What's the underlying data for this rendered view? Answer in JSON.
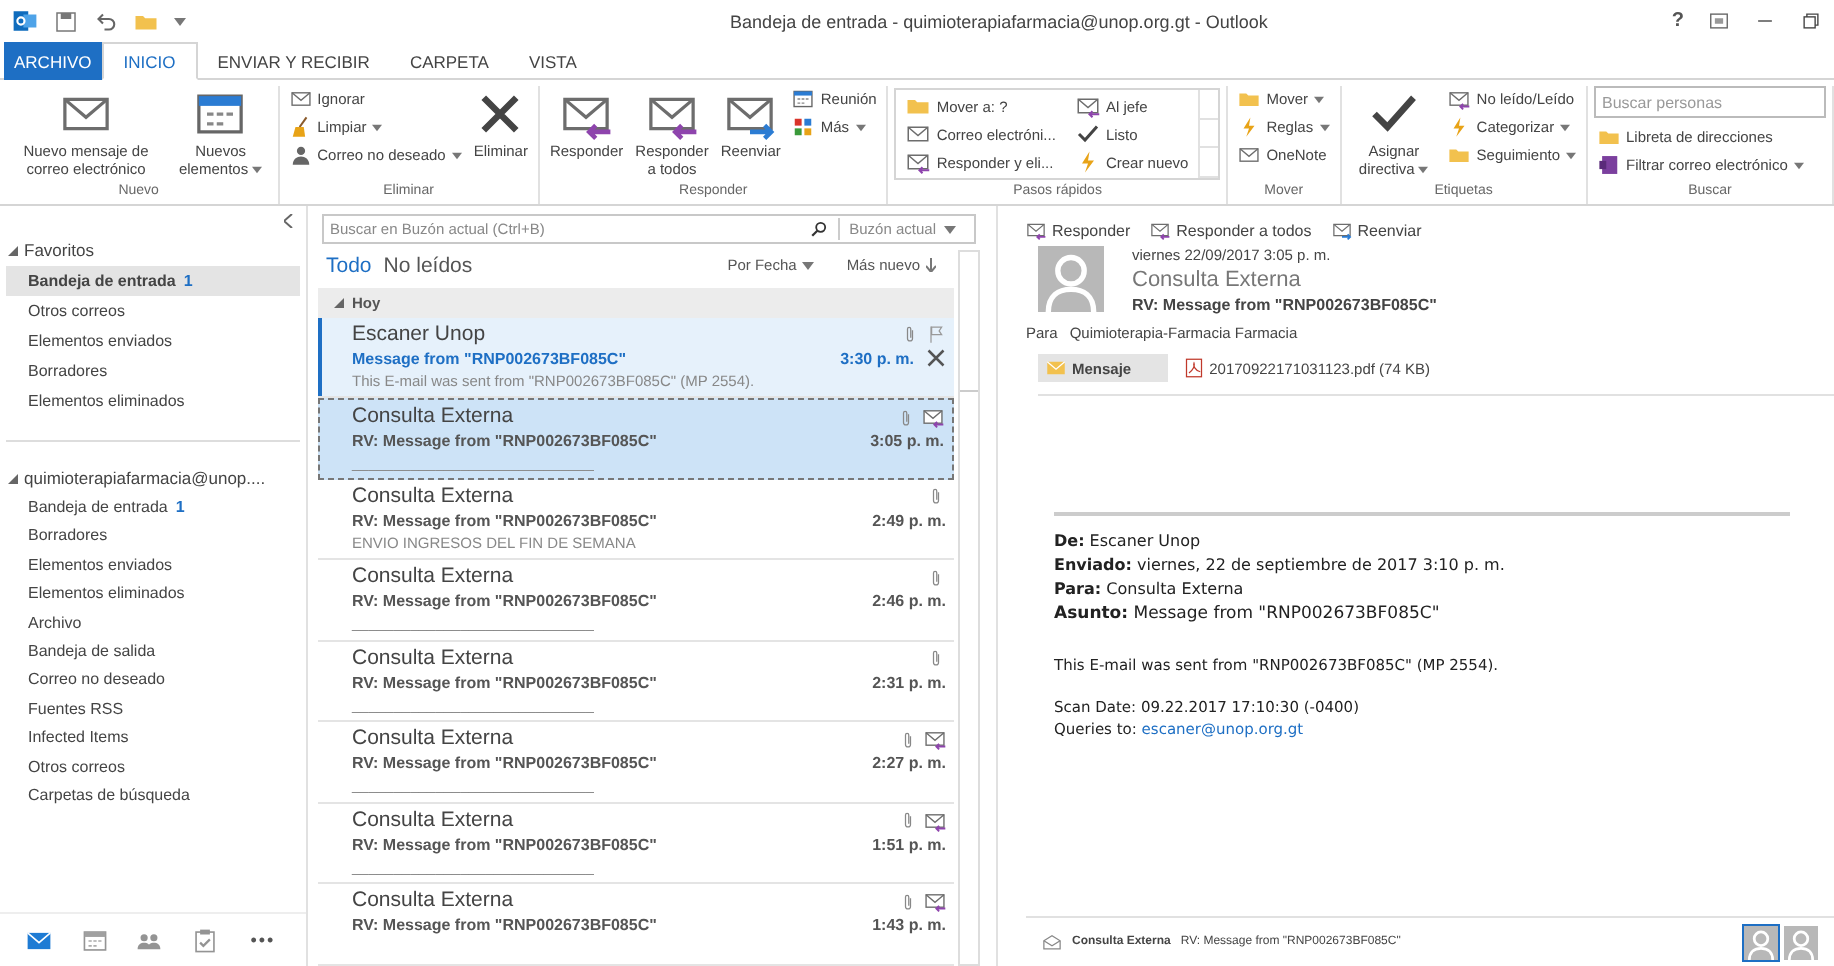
{
  "window": {
    "title": "Bandeja de entrada - quimioterapiafarmacia@unop.org.gt - Outlook",
    "help": "?"
  },
  "ribbon_tabs": [
    {
      "label": "ARCHIVO",
      "kind": "file",
      "selected": false
    },
    {
      "label": "INICIO",
      "kind": "tab",
      "selected": true
    },
    {
      "label": "ENVIAR Y RECIBIR",
      "kind": "tab",
      "selected": false
    },
    {
      "label": "CARPETA",
      "kind": "tab",
      "selected": false
    },
    {
      "label": "VISTA",
      "kind": "tab",
      "selected": false
    }
  ],
  "ribbon_groups": [
    {
      "label": "Nuevo",
      "items": [
        {
          "kind": "large",
          "label": "Nuevo mensaje de correo electrónico",
          "dropdown": false
        },
        {
          "kind": "large",
          "label": "Nuevos elementos",
          "dropdown": true
        }
      ]
    },
    {
      "label": "Eliminar",
      "items": [
        {
          "kind": "stack",
          "entries": [
            {
              "label": "Ignorar",
              "dropdown": false
            },
            {
              "label": "Limpiar",
              "dropdown": true
            },
            {
              "label": "Correo no deseado",
              "dropdown": true
            }
          ]
        },
        {
          "kind": "large",
          "label": "Eliminar",
          "dropdown": false
        }
      ]
    },
    {
      "label": "Responder",
      "items": [
        {
          "kind": "large",
          "label": "Responder",
          "dropdown": false
        },
        {
          "kind": "large",
          "label": "Responder a todos",
          "dropdown": false
        },
        {
          "kind": "large",
          "label": "Reenviar",
          "dropdown": false
        },
        {
          "kind": "stack",
          "entries": [
            {
              "label": "Reunión",
              "dropdown": false
            },
            {
              "label": "Más",
              "dropdown": true
            }
          ]
        }
      ]
    },
    {
      "label": "Pasos rápidos",
      "items": [
        {
          "kind": "gallery",
          "entries": [
            {
              "label": "Mover a: ?"
            },
            {
              "label": "Al jefe"
            },
            {
              "label": "Correo electróni..."
            },
            {
              "label": "Listo"
            },
            {
              "label": "Responder y eli..."
            },
            {
              "label": "Crear nuevo"
            }
          ]
        }
      ]
    },
    {
      "label": "Mover",
      "items": [
        {
          "kind": "stack",
          "entries": [
            {
              "label": "Mover",
              "dropdown": true
            },
            {
              "label": "Reglas",
              "dropdown": true
            },
            {
              "label": "OneNote",
              "dropdown": false
            }
          ]
        }
      ]
    },
    {
      "label": "Etiquetas",
      "items": [
        {
          "kind": "large",
          "label": "Asignar directiva",
          "dropdown": true
        },
        {
          "kind": "stack",
          "entries": [
            {
              "label": "No leído/Leído",
              "dropdown": false
            },
            {
              "label": "Categorizar",
              "dropdown": true
            },
            {
              "label": "Seguimiento",
              "dropdown": true
            }
          ]
        }
      ]
    },
    {
      "label": "Buscar",
      "items": [
        {
          "kind": "search",
          "placeholder": "Buscar personas",
          "entries": [
            {
              "label": "Libreta de direcciones",
              "dropdown": false
            },
            {
              "label": "Filtrar correo electrónico",
              "dropdown": true
            }
          ]
        }
      ]
    }
  ],
  "folder_pane": {
    "sections": [
      {
        "label": "Favoritos",
        "expanded": true,
        "items": [
          {
            "label": "Bandeja de entrada",
            "count": "1",
            "selected": true
          },
          {
            "label": "Otros correos",
            "selected": false
          },
          {
            "label": "Elementos enviados",
            "selected": false
          },
          {
            "label": "Borradores",
            "selected": false
          },
          {
            "label": "Elementos eliminados",
            "selected": false
          }
        ]
      },
      {
        "label": "quimioterapiafarmacia@unop....",
        "expanded": true,
        "items": [
          {
            "label": "Bandeja de entrada",
            "count": "1",
            "selected": false
          },
          {
            "label": "Borradores",
            "selected": false
          },
          {
            "label": "Elementos enviados",
            "selected": false
          },
          {
            "label": "Elementos eliminados",
            "selected": false
          },
          {
            "label": "Archivo",
            "selected": false
          },
          {
            "label": "Bandeja de salida",
            "selected": false
          },
          {
            "label": "Correo no deseado",
            "selected": false
          },
          {
            "label": "Fuentes RSS",
            "selected": false
          },
          {
            "label": "Infected Items",
            "selected": false
          },
          {
            "label": "Otros correos",
            "selected": false
          },
          {
            "label": "Carpetas de búsqueda",
            "selected": false
          }
        ]
      }
    ],
    "nav_buttons": [
      {
        "kind": "mail",
        "selected": true
      },
      {
        "kind": "calendar",
        "selected": false
      },
      {
        "kind": "people",
        "selected": false
      },
      {
        "kind": "tasks",
        "selected": false
      },
      {
        "kind": "more",
        "label": "•••",
        "selected": false
      }
    ]
  },
  "message_list": {
    "search": {
      "placeholder": "Buscar en Buzón actual (Ctrl+B)",
      "scope": "Buzón actual"
    },
    "filters": [
      {
        "label": "Todo",
        "selected": true
      },
      {
        "label": "No leídos",
        "selected": false
      }
    ],
    "sort": "Por Fecha",
    "order": "Más nuevo",
    "group": "Hoy",
    "group_expanded": true,
    "messages": [
      {
        "sender": "Escaner Unop",
        "subject": "Message from \"RNP002673BF085C\"",
        "preview": "This E-mail was sent from \"RNP002673BF085C\" (MP 2554).",
        "time": "3:30 p. m.",
        "unread": true,
        "selected": false,
        "hover": true,
        "attachment": true,
        "flag": true,
        "replied": false
      },
      {
        "sender": "Consulta Externa",
        "subject": "RV: Message from \"RNP002673BF085C\"",
        "preview": "_____________________________",
        "time": "3:05 p. m.",
        "unread": false,
        "selected": true,
        "hover": false,
        "attachment": true,
        "flag": false,
        "replied": true
      },
      {
        "sender": "Consulta Externa",
        "subject": "RV: Message from \"RNP002673BF085C\"",
        "preview": "ENVIO INGRESOS DEL FIN DE SEMANA",
        "time": "2:49 p. m.",
        "unread": false,
        "selected": false,
        "hover": false,
        "attachment": true,
        "flag": false,
        "replied": false
      },
      {
        "sender": "Consulta Externa",
        "subject": "RV: Message from \"RNP002673BF085C\"",
        "preview": "_____________________________",
        "time": "2:46 p. m.",
        "unread": false,
        "selected": false,
        "hover": false,
        "attachment": true,
        "flag": false,
        "replied": false
      },
      {
        "sender": "Consulta Externa",
        "subject": "RV: Message from \"RNP002673BF085C\"",
        "preview": "_____________________________",
        "time": "2:31 p. m.",
        "unread": false,
        "selected": false,
        "hover": false,
        "attachment": true,
        "flag": false,
        "replied": false
      },
      {
        "sender": "Consulta Externa",
        "subject": "RV: Message from \"RNP002673BF085C\"",
        "preview": "_____________________________",
        "time": "2:27 p. m.",
        "unread": false,
        "selected": false,
        "hover": false,
        "attachment": true,
        "flag": false,
        "replied": true
      },
      {
        "sender": "Consulta Externa",
        "subject": "RV: Message from \"RNP002673BF085C\"",
        "preview": "_____________________________",
        "time": "1:51 p. m.",
        "unread": false,
        "selected": false,
        "hover": false,
        "attachment": true,
        "flag": false,
        "replied": true
      },
      {
        "sender": "Consulta Externa",
        "subject": "RV: Message from \"RNP002673BF085C\"",
        "time": "1:43 p. m.",
        "unread": false,
        "selected": false,
        "hover": false,
        "attachment": true,
        "flag": false,
        "replied": true
      }
    ]
  },
  "reading_pane": {
    "actions": [
      "Responder",
      "Responder a todos",
      "Reenviar"
    ],
    "date": "viernes 22/09/2017 3:05 p. m.",
    "sender": "Consulta Externa",
    "subject": "RV: Message from \"RNP002673BF085C\"",
    "to_label": "Para",
    "to": "Quimioterapia-Farmacia Farmacia",
    "attachments": [
      {
        "kind": "message",
        "label": "Mensaje",
        "selected": true
      },
      {
        "kind": "pdf",
        "label": "20170922171031123.pdf (74 KB)",
        "selected": false
      }
    ],
    "header_lines": [
      "**De:** Escaner Unop",
      "**Enviado:** viernes, 22 de septiembre de 2017 3:10 p. m.",
      "**Para:** Consulta Externa",
      "**Asunto:** Message from \"RNP002673BF085C\""
    ],
    "body": [
      "This E-mail was sent from \"RNP002673BF085C\" (MP 2554).",
      "Scan Date: 09.22.2017 17:10:30 (-0400)"
    ],
    "queries_label": "Queries to:",
    "queries_link": "escaner@unop.org.gt",
    "people_pane": {
      "sender": "Consulta Externa",
      "subject": "RV: Message from \"RNP002673BF085C\"",
      "avatars": [
        {
          "selected": true
        },
        {
          "selected": false
        }
      ]
    }
  }
}
